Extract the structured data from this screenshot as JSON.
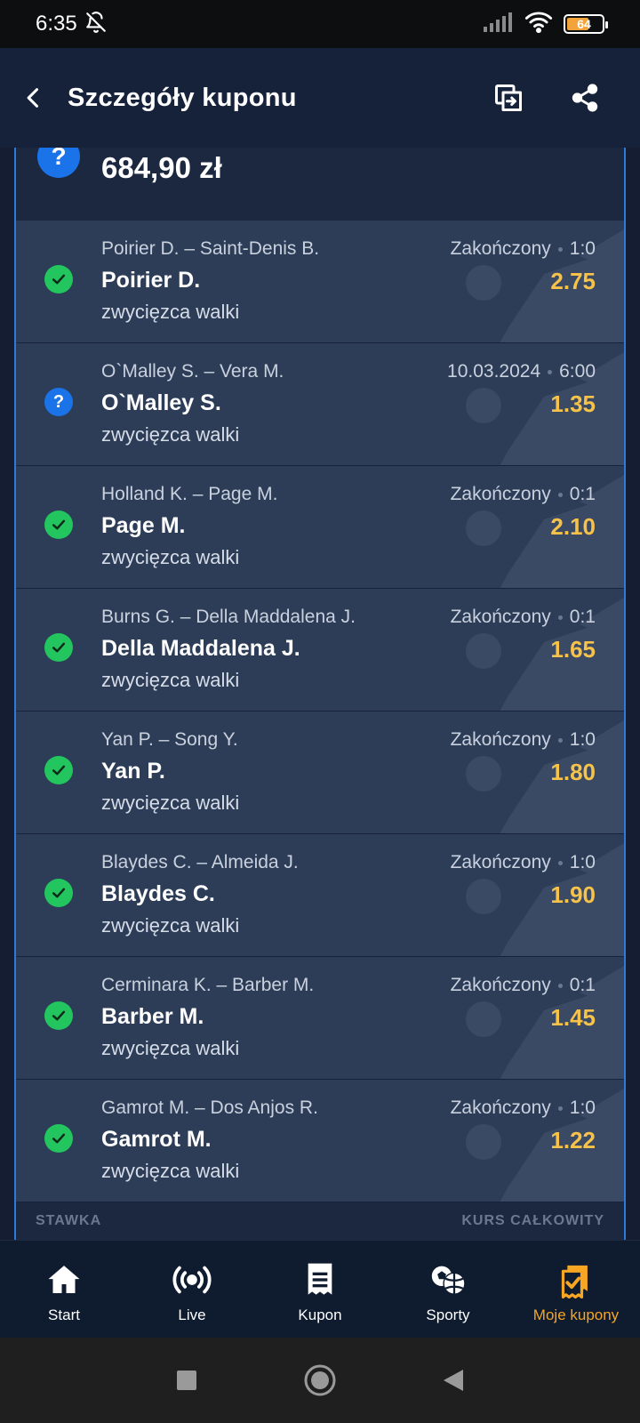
{
  "status_bar": {
    "time": "6:35",
    "battery": "64",
    "battery_level": 0.64
  },
  "header": {
    "title": "Szczegóły kuponu"
  },
  "summary": {
    "amount": "684,90 zł",
    "status_icon": "?"
  },
  "bets": [
    {
      "match": "Poirier D. – Saint-Denis B.",
      "pick": "Poirier D.",
      "market": "zwycięzca walki",
      "status_label": "Zakończony",
      "score": "1:0",
      "odds": "2.75",
      "status": "won"
    },
    {
      "match": "O`Malley S. – Vera M.",
      "pick": "O`Malley S.",
      "market": "zwycięzca walki",
      "status_label": "10.03.2024",
      "score": "6:00",
      "odds": "1.35",
      "status": "pending"
    },
    {
      "match": "Holland K. – Page M.",
      "pick": "Page M.",
      "market": "zwycięzca walki",
      "status_label": "Zakończony",
      "score": "0:1",
      "odds": "2.10",
      "status": "won"
    },
    {
      "match": "Burns G. – Della Maddalena J.",
      "pick": "Della Maddalena J.",
      "market": "zwycięzca walki",
      "status_label": "Zakończony",
      "score": "0:1",
      "odds": "1.65",
      "status": "won"
    },
    {
      "match": "Yan P. – Song Y.",
      "pick": "Yan P.",
      "market": "zwycięzca walki",
      "status_label": "Zakończony",
      "score": "1:0",
      "odds": "1.80",
      "status": "won"
    },
    {
      "match": "Blaydes C. – Almeida J.",
      "pick": "Blaydes C.",
      "market": "zwycięzca walki",
      "status_label": "Zakończony",
      "score": "1:0",
      "odds": "1.90",
      "status": "won"
    },
    {
      "match": "Cerminara K. – Barber M.",
      "pick": "Barber M.",
      "market": "zwycięzca walki",
      "status_label": "Zakończony",
      "score": "0:1",
      "odds": "1.45",
      "status": "won"
    },
    {
      "match": "Gamrot M. – Dos Anjos R.",
      "pick": "Gamrot M.",
      "market": "zwycięzca walki",
      "status_label": "Zakończony",
      "score": "1:0",
      "odds": "1.22",
      "status": "won"
    }
  ],
  "footer": {
    "stake_label": "STAWKA",
    "total_odds_label": "KURS CAŁKOWITY"
  },
  "bottom_nav": {
    "items": [
      {
        "label": "Start",
        "icon": "home-icon"
      },
      {
        "label": "Live",
        "icon": "live-icon"
      },
      {
        "label": "Kupon",
        "icon": "coupon-icon"
      },
      {
        "label": "Sporty",
        "icon": "sports-icon"
      },
      {
        "label": "Moje kupony",
        "icon": "my-coupons-icon"
      }
    ],
    "active_index": 4
  },
  "colors": {
    "accent": "#f6a623",
    "odds": "#f6c24a",
    "success": "#22c55e",
    "pending": "#1a73e8",
    "row_bg": "#2d3d57",
    "header_bg": "#16213a"
  }
}
